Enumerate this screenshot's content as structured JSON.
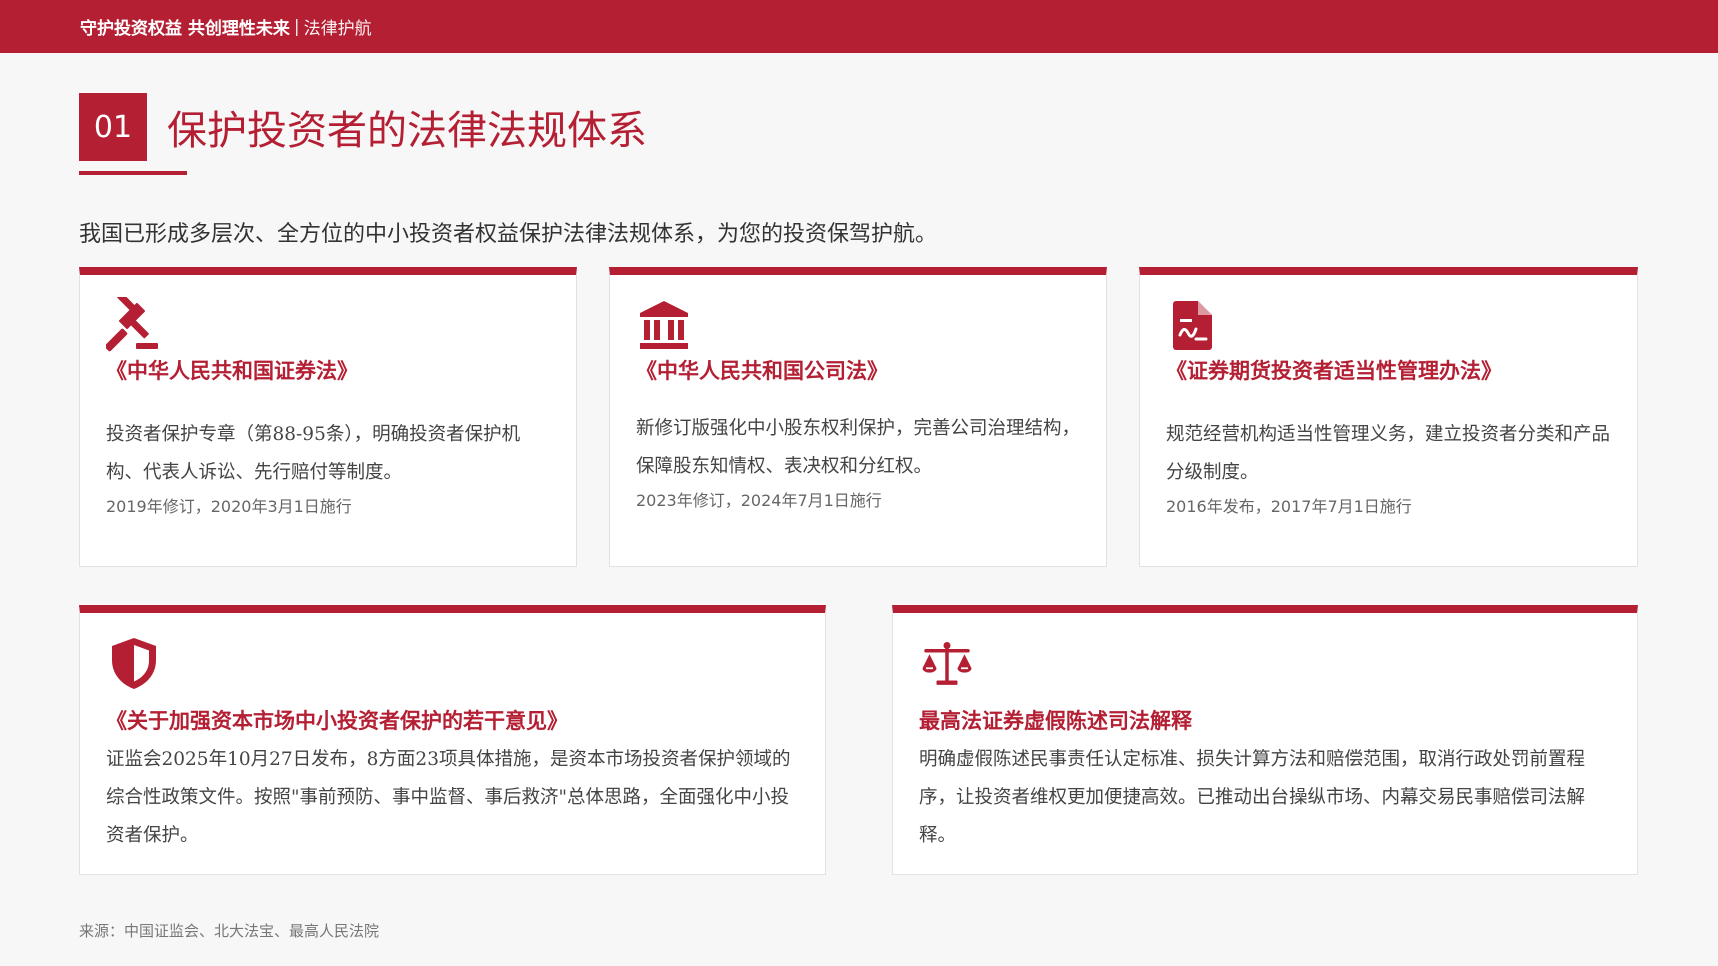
{
  "header": {
    "title": "守护投资权益 共创理性未来",
    "separator": "|",
    "subtitle": "法律护航"
  },
  "section": {
    "number": "01",
    "title": "保护投资者的法律法规体系"
  },
  "intro": "我国已形成多层次、全方位的中小投资者权益保护法律法规体系，为您的投资保驾护航。",
  "cards": [
    {
      "icon": "gavel-icon",
      "title": "《中华人民共和国证券法》",
      "desc": "投资者保护专章（第88-95条），明确投资者保护机构、代表人诉讼、先行赔付等制度。",
      "date": "2019年修订，2020年3月1日施行"
    },
    {
      "icon": "bank-icon",
      "title": "《中华人民共和国公司法》",
      "desc": "新修订版强化中小股东权利保护，完善公司治理结构，保障股东知情权、表决权和分红权。",
      "date": "2023年修订，2024年7月1日施行"
    },
    {
      "icon": "document-icon",
      "title": "《证券期货投资者适当性管理办法》",
      "desc": "规范经营机构适当性管理义务，建立投资者分类和产品分级制度。",
      "date": "2016年发布，2017年7月1日施行"
    },
    {
      "icon": "shield-icon",
      "title": "《关于加强资本市场中小投资者保护的若干意见》",
      "desc": "证监会2025年10月27日发布，8方面23项具体措施，是资本市场投资者保护领域的综合性政策文件。按照\"事前预防、事中监督、事后救济\"总体思路，全面强化中小投资者保护。"
    },
    {
      "icon": "scale-icon",
      "title": "最高法证券虚假陈述司法解释",
      "desc": "明确虚假陈述民事责任认定标准、损失计算方法和赔偿范围，取消行政处罚前置程序，让投资者维权更加便捷高效。已推动出台操纵市场、内幕交易民事赔偿司法解释。"
    }
  ],
  "source": "来源：中国证监会、北大法宝、最高人民法院",
  "colors": {
    "accent": "#b41f33",
    "background": "#f7f7f7"
  }
}
